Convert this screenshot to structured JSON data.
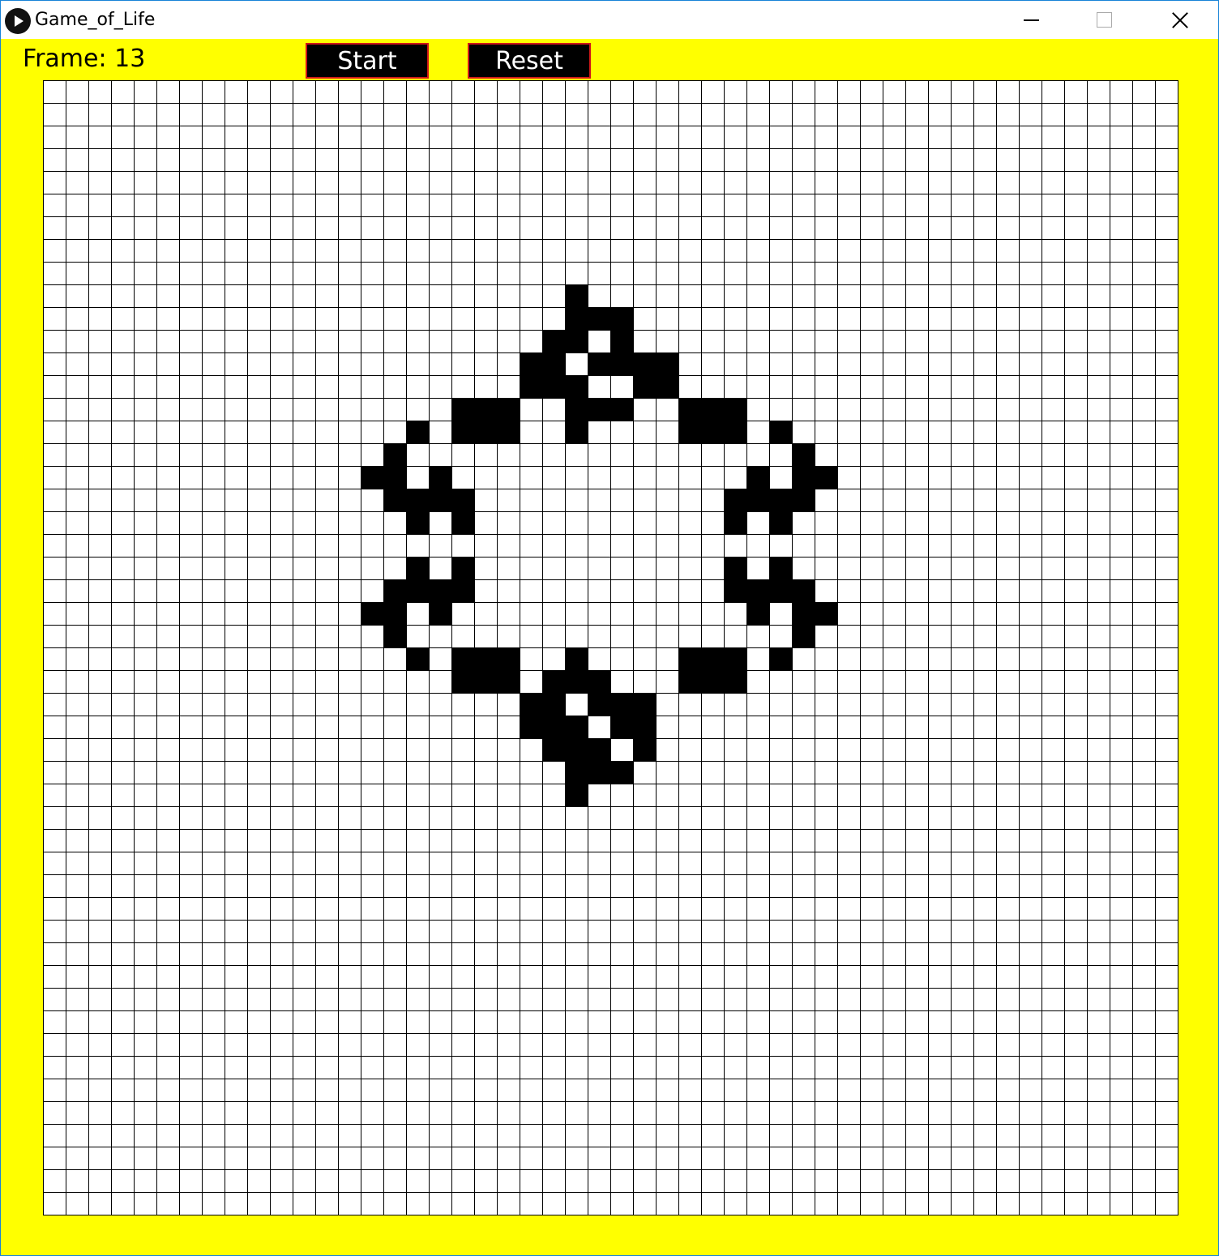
{
  "window": {
    "title": "Game_of_Life",
    "icon": "play-icon"
  },
  "toolbar": {
    "frame_label": "Frame: 13",
    "start_label": "Start",
    "reset_label": "Reset"
  },
  "colors": {
    "background": "#ffff00",
    "button_bg": "#000000",
    "button_border": "#d01818",
    "cell_alive": "#000000",
    "cell_dead": "#ffffff"
  },
  "board": {
    "cols": 50,
    "rows": 50,
    "live_cells": [
      [
        23,
        9
      ],
      [
        23,
        10
      ],
      [
        24,
        10
      ],
      [
        25,
        10
      ],
      [
        22,
        11
      ],
      [
        23,
        11
      ],
      [
        25,
        11
      ],
      [
        21,
        12
      ],
      [
        22,
        12
      ],
      [
        24,
        12
      ],
      [
        25,
        12
      ],
      [
        26,
        12
      ],
      [
        27,
        12
      ],
      [
        21,
        13
      ],
      [
        22,
        13
      ],
      [
        23,
        13
      ],
      [
        26,
        13
      ],
      [
        27,
        13
      ],
      [
        18,
        14
      ],
      [
        19,
        14
      ],
      [
        20,
        14
      ],
      [
        23,
        14
      ],
      [
        24,
        14
      ],
      [
        25,
        14
      ],
      [
        28,
        14
      ],
      [
        29,
        14
      ],
      [
        30,
        14
      ],
      [
        16,
        15
      ],
      [
        18,
        15
      ],
      [
        19,
        15
      ],
      [
        20,
        15
      ],
      [
        23,
        15
      ],
      [
        28,
        15
      ],
      [
        29,
        15
      ],
      [
        30,
        15
      ],
      [
        32,
        15
      ],
      [
        15,
        16
      ],
      [
        33,
        16
      ],
      [
        14,
        17
      ],
      [
        15,
        17
      ],
      [
        17,
        17
      ],
      [
        31,
        17
      ],
      [
        33,
        17
      ],
      [
        34,
        17
      ],
      [
        15,
        18
      ],
      [
        16,
        18
      ],
      [
        17,
        18
      ],
      [
        18,
        18
      ],
      [
        30,
        18
      ],
      [
        31,
        18
      ],
      [
        32,
        18
      ],
      [
        33,
        18
      ],
      [
        16,
        19
      ],
      [
        18,
        19
      ],
      [
        30,
        19
      ],
      [
        32,
        19
      ],
      [
        16,
        21
      ],
      [
        18,
        21
      ],
      [
        30,
        21
      ],
      [
        32,
        21
      ],
      [
        15,
        22
      ],
      [
        16,
        22
      ],
      [
        17,
        22
      ],
      [
        18,
        22
      ],
      [
        30,
        22
      ],
      [
        31,
        22
      ],
      [
        32,
        22
      ],
      [
        33,
        22
      ],
      [
        14,
        23
      ],
      [
        15,
        23
      ],
      [
        17,
        23
      ],
      [
        31,
        23
      ],
      [
        33,
        23
      ],
      [
        34,
        23
      ],
      [
        15,
        24
      ],
      [
        33,
        24
      ],
      [
        16,
        25
      ],
      [
        18,
        25
      ],
      [
        19,
        25
      ],
      [
        20,
        25
      ],
      [
        23,
        25
      ],
      [
        28,
        25
      ],
      [
        29,
        25
      ],
      [
        30,
        25
      ],
      [
        32,
        25
      ],
      [
        18,
        26
      ],
      [
        19,
        26
      ],
      [
        20,
        26
      ],
      [
        22,
        26
      ],
      [
        23,
        26
      ],
      [
        24,
        26
      ],
      [
        28,
        26
      ],
      [
        29,
        26
      ],
      [
        30,
        26
      ],
      [
        21,
        27
      ],
      [
        22,
        27
      ],
      [
        24,
        27
      ],
      [
        25,
        27
      ],
      [
        26,
        27
      ],
      [
        21,
        28
      ],
      [
        22,
        28
      ],
      [
        23,
        28
      ],
      [
        25,
        28
      ],
      [
        26,
        28
      ],
      [
        22,
        29
      ],
      [
        23,
        29
      ],
      [
        24,
        29
      ],
      [
        26,
        29
      ],
      [
        23,
        30
      ],
      [
        24,
        30
      ],
      [
        25,
        30
      ],
      [
        23,
        31
      ]
    ]
  }
}
